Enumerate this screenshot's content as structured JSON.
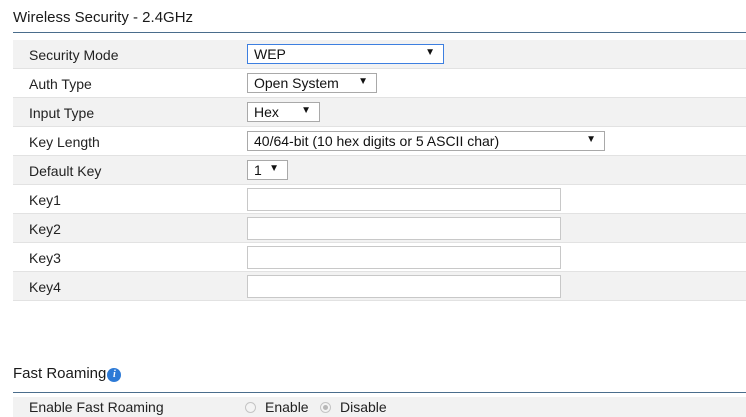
{
  "wireless_security": {
    "title": "Wireless Security - 2.4GHz",
    "security_mode": {
      "label": "Security Mode",
      "value": "WEP"
    },
    "auth_type": {
      "label": "Auth Type",
      "value": "Open System"
    },
    "input_type": {
      "label": "Input Type",
      "value": "Hex"
    },
    "key_length": {
      "label": "Key Length",
      "value": "40/64-bit (10 hex digits or 5 ASCII char)"
    },
    "default_key": {
      "label": "Default Key",
      "value": "1"
    },
    "keys": [
      {
        "label": "Key1",
        "value": ""
      },
      {
        "label": "Key2",
        "value": ""
      },
      {
        "label": "Key3",
        "value": ""
      },
      {
        "label": "Key4",
        "value": ""
      }
    ]
  },
  "fast_roaming": {
    "title": "Fast Roaming",
    "info_icon": "info-icon",
    "enable_label": "Enable Fast Roaming",
    "options": [
      "Enable",
      "Disable"
    ],
    "selected": "Disable"
  }
}
